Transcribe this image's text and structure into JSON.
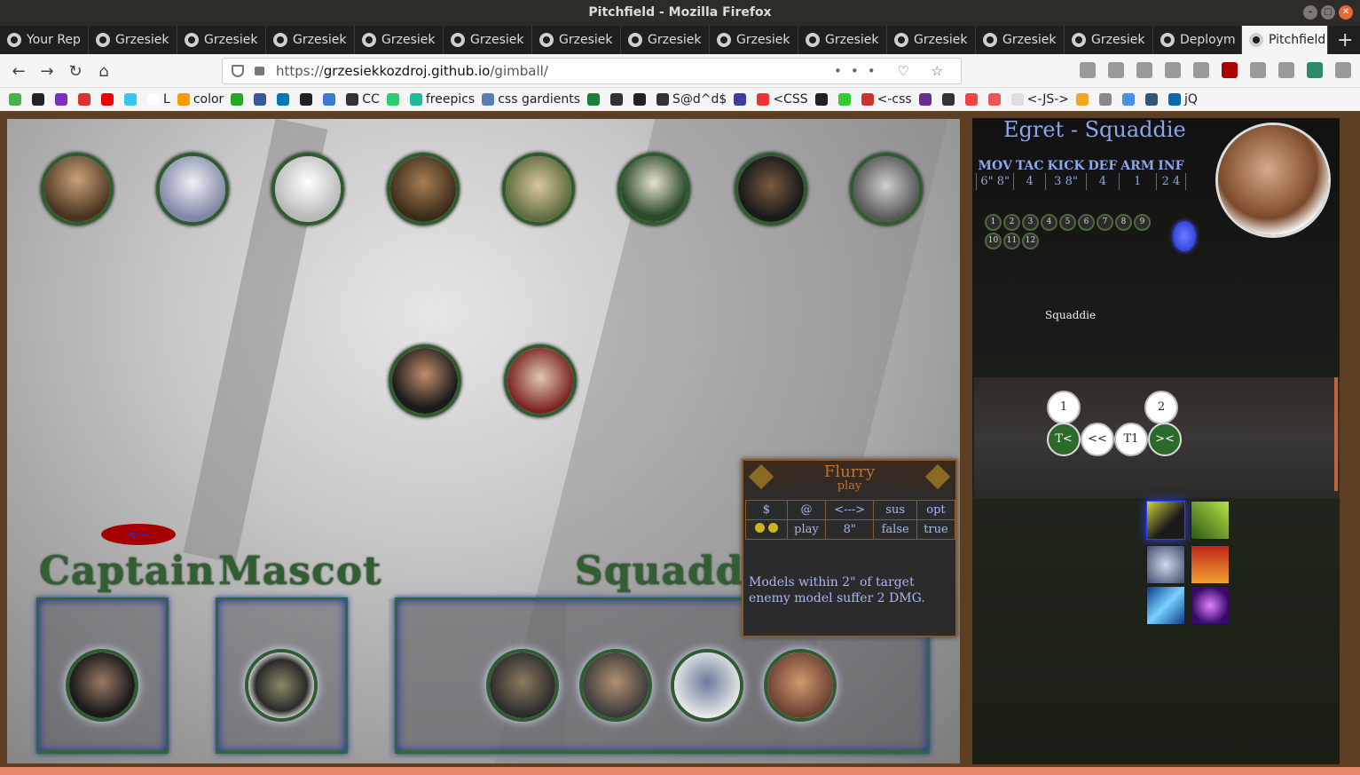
{
  "window": {
    "title": "Pitchfield - Mozilla Firefox"
  },
  "tabs": [
    {
      "label": "Your Rep"
    },
    {
      "label": "Grzesiek"
    },
    {
      "label": "Grzesiek"
    },
    {
      "label": "Grzesiek"
    },
    {
      "label": "Grzesiek"
    },
    {
      "label": "Grzesiek"
    },
    {
      "label": "Grzesiek"
    },
    {
      "label": "Grzesiek"
    },
    {
      "label": "Grzesiek"
    },
    {
      "label": "Grzesiek"
    },
    {
      "label": "Grzesiek"
    },
    {
      "label": "Grzesiek"
    },
    {
      "label": "Grzesiek"
    },
    {
      "label": "Deploym"
    },
    {
      "label": "Pitchfield"
    }
  ],
  "nav": {
    "url_prefix": "https://",
    "url_host": "grzesiekkozdroj.github.io",
    "url_path": "/gimball/",
    "actions": "••• ♡ ☆"
  },
  "bookmarks": [
    {
      "label": "",
      "color": "#4caf50"
    },
    {
      "label": "",
      "color": "#222"
    },
    {
      "label": "",
      "color": "#7b2fbe"
    },
    {
      "label": "",
      "color": "#d33"
    },
    {
      "label": "",
      "color": "#e00"
    },
    {
      "label": "",
      "color": "#36c5f0"
    },
    {
      "label": "L",
      "color": "#fff"
    },
    {
      "label": "color",
      "color": "#f90"
    },
    {
      "label": "",
      "color": "#2a2"
    },
    {
      "label": "",
      "color": "#3b5998"
    },
    {
      "label": "",
      "color": "#0077b5"
    },
    {
      "label": "",
      "color": "#222"
    },
    {
      "label": "",
      "color": "#3a7bd5"
    },
    {
      "label": "CC",
      "color": "#333"
    },
    {
      "label": "",
      "color": "#2ecc71"
    },
    {
      "label": "freepics",
      "color": "#1abc9c"
    },
    {
      "label": "css gardients",
      "color": "#5b7db1"
    },
    {
      "label": "",
      "color": "#1a7f37"
    },
    {
      "label": "",
      "color": "#333"
    },
    {
      "label": "",
      "color": "#222"
    },
    {
      "label": "S@d^d$",
      "color": "#333"
    },
    {
      "label": "",
      "color": "#3c3c9e"
    },
    {
      "label": "<CSS",
      "color": "#e33"
    },
    {
      "label": "",
      "color": "#222"
    },
    {
      "label": "",
      "color": "#3c3"
    },
    {
      "label": "<-css",
      "color": "#c33"
    },
    {
      "label": "",
      "color": "#6a2c91"
    },
    {
      "label": "",
      "color": "#333"
    },
    {
      "label": "",
      "color": "#e44"
    },
    {
      "label": "",
      "color": "#e55"
    },
    {
      "label": "<-JS->",
      "color": "#ddd"
    },
    {
      "label": "",
      "color": "#f5a623"
    },
    {
      "label": "",
      "color": "#888"
    },
    {
      "label": "",
      "color": "#4a90e2"
    },
    {
      "label": "",
      "color": "#357"
    },
    {
      "label": "jQ",
      "color": "#0769ad"
    }
  ],
  "board": {
    "back_button": "<---",
    "labels": {
      "captain": "Captain",
      "mascot": "Mascot",
      "squaddie": "Squaddie"
    }
  },
  "card": {
    "name": "Flurry",
    "type": "play",
    "headers": [
      "$",
      "@",
      "<--->",
      "sus",
      "opt"
    ],
    "values": [
      "",
      "play",
      "8\"",
      "false",
      "true"
    ],
    "cost_dots": 2,
    "text": "Models within 2\" of target enemy model suffer 2 DMG."
  },
  "panel": {
    "name": "Egret - Squaddie",
    "stat_headers": [
      "MOV",
      "TAC",
      "KICK",
      "DEF",
      "ARM",
      "INF"
    ],
    "stat_values": [
      "6\" 8\"",
      "4",
      "3 8\"",
      "4",
      "1",
      "2 4"
    ],
    "health": [
      "1",
      "2",
      "3",
      "4",
      "5",
      "6",
      "7",
      "8",
      "9",
      "10",
      "11",
      "12"
    ],
    "role": "Squaddie",
    "playbook": {
      "top": [
        "1",
        "2"
      ],
      "bottom": [
        "T<",
        "<<",
        "T1",
        ">< "
      ]
    }
  },
  "colors": {
    "accent": "#8ca6ee",
    "card_border": "#8b5a2b",
    "token_ring": "#2f5c2f"
  }
}
